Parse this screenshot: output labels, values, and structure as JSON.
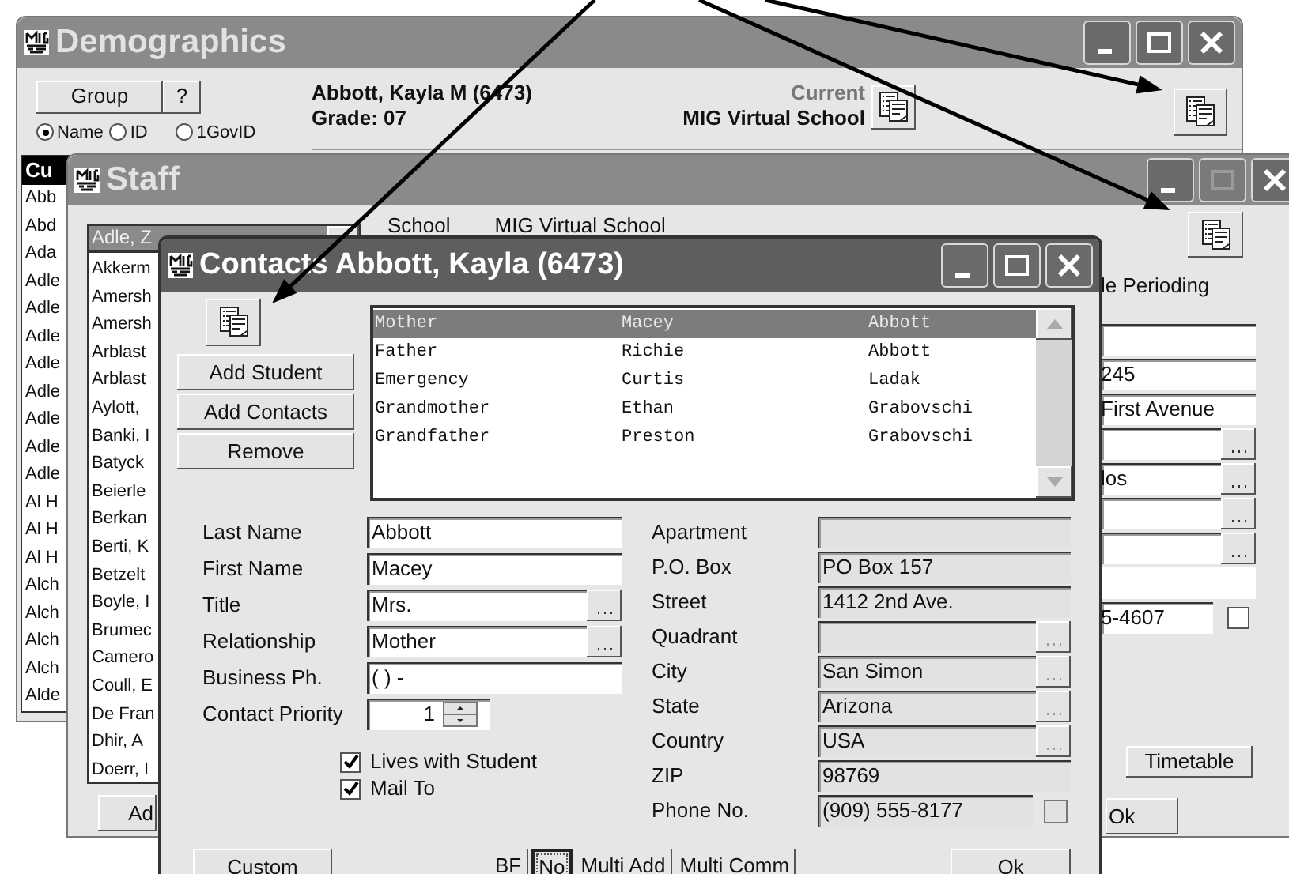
{
  "demographics": {
    "title": "Demographics",
    "controls": [
      {
        "kind": "minimize",
        "disabled": false
      },
      {
        "kind": "maximize",
        "disabled": false
      },
      {
        "kind": "close",
        "disabled": false
      }
    ],
    "group_button": "Group",
    "help_button": "?",
    "search_by": [
      {
        "label": "Name",
        "selected": true
      },
      {
        "label": "ID",
        "selected": false
      },
      {
        "label": "1GovID",
        "selected": false
      }
    ],
    "student": "Abbott, Kayla M (6473)",
    "grade": "Grade: 07",
    "status": "Current",
    "school": "MIG Virtual School",
    "list_header": "Cu",
    "list": [
      "Abb",
      "Abd",
      "Ada",
      "Adle",
      "Adle",
      "Adle",
      "Adle",
      "Adle",
      "Adle",
      "Adle",
      "Adle",
      "Al H",
      "Al H",
      "Al H",
      "Alch",
      "Alch",
      "Alch",
      "Alch",
      "Alde"
    ]
  },
  "staff": {
    "title": "Staff",
    "controls": [
      {
        "kind": "minimize",
        "disabled": false
      },
      {
        "kind": "maximize",
        "disabled": true
      },
      {
        "kind": "close",
        "disabled": false
      }
    ],
    "selected_staff": "Adle, Z",
    "school_label": "School",
    "school": "MIG Virtual School",
    "list": [
      "Akkerm",
      "Amersh",
      "Amersh",
      "Arblast",
      "Arblast",
      "Aylott,",
      "Banki, I",
      "Batyck",
      "Beierle",
      "Berkan",
      "Berti, K",
      "Betzelt",
      "Boyle, I",
      "Brumec",
      "Camero",
      "Coull, E",
      "De Fran",
      "Dhir, A",
      "Doerr, I"
    ],
    "add_button": "Ad",
    "column_3": "le Perioding",
    "fields": [
      {
        "kind": "text"
      },
      {
        "kind": "text",
        "value": "245"
      },
      {
        "kind": "text",
        "value": "First Avenue"
      },
      {
        "kind": "lookup"
      },
      {
        "kind": "lookup",
        "value": "los"
      },
      {
        "kind": "lookup"
      },
      {
        "kind": "lookup"
      },
      {
        "kind": "plain"
      },
      {
        "kind": "phone",
        "value": "5-4607",
        "checked": false
      }
    ],
    "timetable_button": "Timetable",
    "ok_button": "Ok"
  },
  "contacts": {
    "title": "Contacts Abbott, Kayla (6473)",
    "controls": [
      {
        "kind": "minimize",
        "disabled": false
      },
      {
        "kind": "maximize",
        "disabled": false
      },
      {
        "kind": "close",
        "disabled": false
      }
    ],
    "buttons": [
      "Add Student",
      "Add Contacts",
      "Remove"
    ],
    "rows": [
      {
        "relationship": "Mother",
        "first_name": "Macey",
        "last_name": "Abbott",
        "selected": true
      },
      {
        "relationship": "Father",
        "first_name": "Richie",
        "last_name": "Abbott",
        "selected": false
      },
      {
        "relationship": "Emergency",
        "first_name": "Curtis",
        "last_name": "Ladak",
        "selected": false
      },
      {
        "relationship": "Grandmother",
        "first_name": "Ethan",
        "last_name": "Grabovschi",
        "selected": false
      },
      {
        "relationship": "Grandfather",
        "first_name": "Preston",
        "last_name": "Grabovschi",
        "selected": false
      }
    ],
    "left_fields": [
      {
        "label": "Last Name",
        "kind": "text",
        "value": "Abbott"
      },
      {
        "label": "First Name",
        "kind": "text",
        "value": "Macey"
      },
      {
        "label": "Title",
        "kind": "lookup",
        "value": "Mrs."
      },
      {
        "label": "Relationship",
        "kind": "lookup",
        "value": "Mother"
      },
      {
        "label": "Business Ph.",
        "kind": "text",
        "value": "( )   -"
      },
      {
        "label": "Contact Priority",
        "kind": "spinner",
        "value": "1"
      }
    ],
    "checkboxes": [
      {
        "label": "Lives with Student",
        "checked": true
      },
      {
        "label": "Mail To",
        "checked": true
      }
    ],
    "right_fields": [
      {
        "label": "Apartment",
        "kind": "text"
      },
      {
        "label": "P.O. Box",
        "kind": "text",
        "value": "PO Box 157"
      },
      {
        "label": "Street",
        "kind": "text",
        "value": "1412 2nd Ave."
      },
      {
        "label": "Quadrant",
        "kind": "lookup"
      },
      {
        "label": "City",
        "kind": "lookup",
        "value": "San Simon"
      },
      {
        "label": "State",
        "kind": "lookup",
        "value": "Arizona"
      },
      {
        "label": "Country",
        "kind": "lookup",
        "value": "USA"
      },
      {
        "label": "ZIP",
        "kind": "text",
        "value": "98769"
      },
      {
        "label": "Phone No.",
        "kind": "phone",
        "value": "(909) 555-8177",
        "checked": false
      }
    ],
    "custom_button": "Custom",
    "tools": [
      {
        "label": "BF",
        "pressed": false
      },
      {
        "label": "No",
        "pressed": true
      },
      {
        "label": "Multi Add",
        "pressed": false
      },
      {
        "label": "Multi Comm",
        "pressed": false
      }
    ],
    "ok_button": "Ok"
  }
}
